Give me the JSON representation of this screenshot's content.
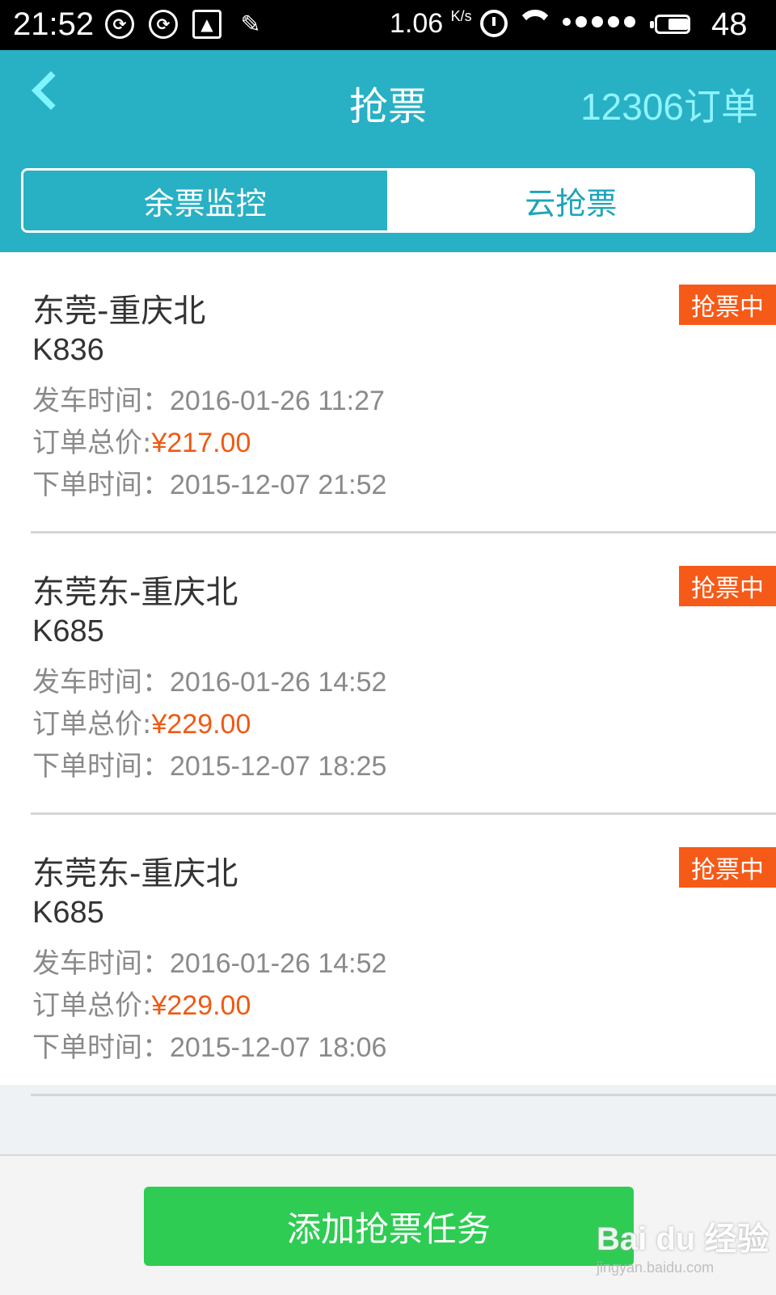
{
  "status_bar": {
    "time": "21:52",
    "speed": "1.06",
    "speed_unit": "K/s",
    "battery": "48",
    "icons": [
      "sync-icon",
      "sync-icon",
      "image-icon",
      "broom-icon",
      "alarm-icon",
      "wifi-icon",
      "signal-icon",
      "battery-icon"
    ]
  },
  "header": {
    "title": "抢票",
    "right_link": "12306订单"
  },
  "tabs": [
    {
      "label": "余票监控",
      "active": false
    },
    {
      "label": "云抢票",
      "active": true
    }
  ],
  "orders": [
    {
      "route": "东莞-重庆北",
      "train": "K836",
      "depart_label": "发车时间：",
      "depart_time": "2016-01-26 11:27",
      "price_label": "订单总价:",
      "price": "¥217.00",
      "order_label": "下单时间：",
      "order_time": "2015-12-07 21:52",
      "status": "抢票中"
    },
    {
      "route": "东莞东-重庆北",
      "train": "K685",
      "depart_label": "发车时间：",
      "depart_time": "2016-01-26 14:52",
      "price_label": "订单总价:",
      "price": "¥229.00",
      "order_label": "下单时间：",
      "order_time": "2015-12-07 18:25",
      "status": "抢票中"
    },
    {
      "route": "东莞东-重庆北",
      "train": "K685",
      "depart_label": "发车时间：",
      "depart_time": "2016-01-26 14:52",
      "price_label": "订单总价:",
      "price": "¥229.00",
      "order_label": "下单时间：",
      "order_time": "2015-12-07 18:06",
      "status": "抢票中"
    }
  ],
  "bottom": {
    "add_button": "添加抢票任务"
  },
  "watermark": {
    "main": "Bai du 经验",
    "sub": "jingyan.baidu.com"
  },
  "colors": {
    "header": "#28b0c4",
    "accent_link": "#8ff3ff",
    "status_badge": "#f55a18",
    "price": "#ef5a14",
    "add_button": "#2fcc53"
  }
}
